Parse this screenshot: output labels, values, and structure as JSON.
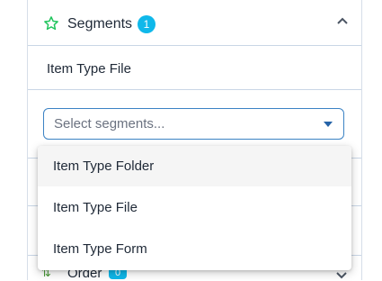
{
  "segments": {
    "title": "Segments",
    "count": "1",
    "selected_item": "Item Type File",
    "select": {
      "placeholder": "Select segments..."
    },
    "options": [
      "Item Type Folder",
      "Item Type File",
      "Item Type Form"
    ]
  },
  "order": {
    "title": "Order",
    "count": "0"
  },
  "colors": {
    "accent": "#0fb8ea",
    "star": "#22c55e",
    "border_focus": "#3b82c4"
  },
  "icons": [
    "star-icon",
    "chevron-up-icon",
    "caret-down-icon",
    "sort-icon",
    "chevron-down-icon"
  ]
}
